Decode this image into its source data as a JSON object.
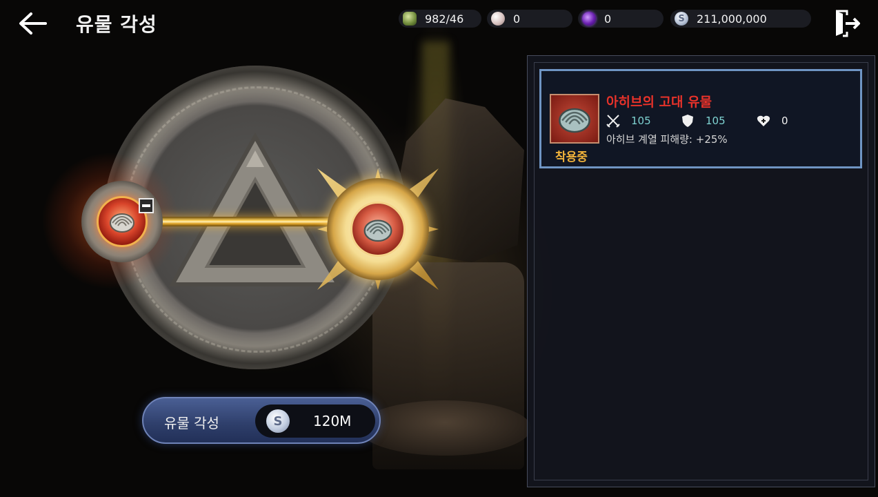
{
  "header": {
    "title": "유물 각성"
  },
  "currencies": [
    {
      "icon": "green-stone-icon",
      "value": "982/46"
    },
    {
      "icon": "pearl-icon",
      "value": "0"
    },
    {
      "icon": "purple-orb-icon",
      "value": "0"
    },
    {
      "icon": "silver-coin-icon",
      "value": "211,000,000"
    }
  ],
  "awaken": {
    "label": "유물 각성",
    "cost_icon": "silver-coin-icon",
    "cost": "120M"
  },
  "relic_list": [
    {
      "name": "아히브의 고대 유물",
      "name_color": "#e8322a",
      "status": "착용중",
      "attack": "105",
      "defense": "105",
      "hp": "0",
      "effect": "아히브 계열 피해량: +25%"
    }
  ],
  "colors": {
    "accent_gold": "#f0b23a",
    "card_border": "#6f95c4",
    "stat_teal": "#7fd3d2",
    "button_blue": "#2e3e6a"
  }
}
